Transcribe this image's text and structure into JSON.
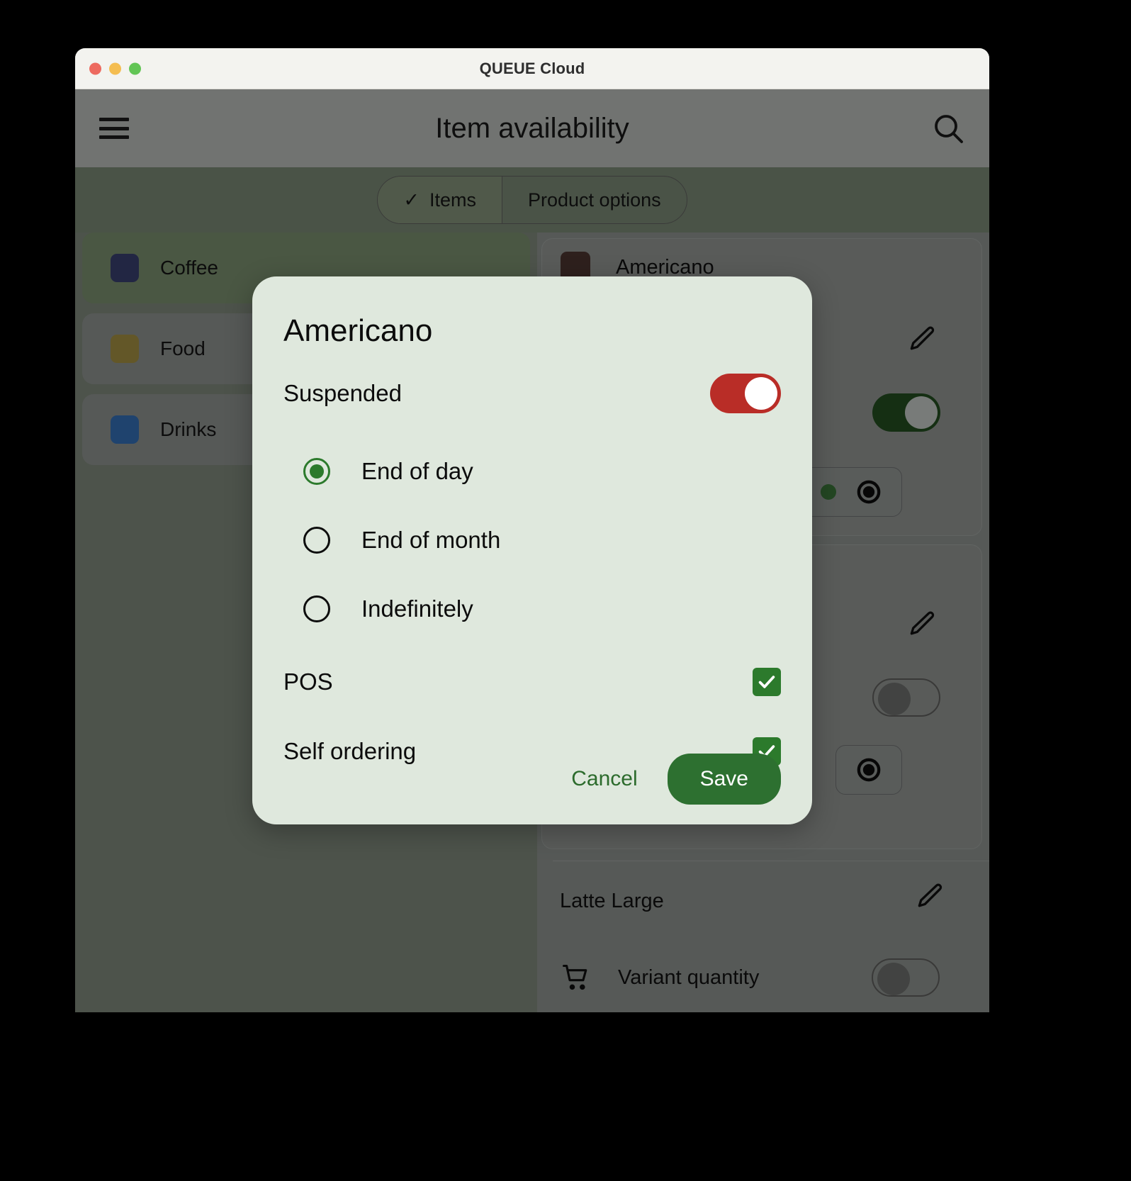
{
  "window": {
    "title": "QUEUE Cloud",
    "traffic_lights": [
      "close-red",
      "minimize-yellow",
      "maximize-green"
    ]
  },
  "appbar": {
    "menu_icon": "hamburger-icon",
    "title": "Item availability",
    "search_icon": "search-icon"
  },
  "tabs": {
    "items": {
      "label": "Items",
      "check": "✓",
      "selected": true
    },
    "product_options": {
      "label": "Product options",
      "selected": false
    }
  },
  "sidebar": {
    "categories": [
      {
        "label": "Coffee",
        "color": "#2c3157",
        "selected": true
      },
      {
        "label": "Food",
        "color": "#7f7034",
        "selected": false
      },
      {
        "label": "Drinks",
        "color": "#28568e",
        "selected": false
      }
    ]
  },
  "list": {
    "items": [
      {
        "name": "Americano",
        "swatch": "#3c2a26",
        "edit_icon": "pencil-icon",
        "toggle_state": "on",
        "chip": {
          "dot_color": "#2d5a2c",
          "icon": "target-icon"
        }
      },
      {
        "name": "Latte Large",
        "edit_icon": "pencil-icon",
        "toggle_state": "off",
        "sub_row": {
          "icon": "shopping-cart-icon",
          "label": "Variant quantity",
          "toggle_state": "off"
        }
      }
    ]
  },
  "dialog": {
    "title": "Americano",
    "suspended": {
      "label": "Suspended",
      "enabled": true,
      "toggle_color": "#b92d27"
    },
    "duration_options": [
      {
        "label": "End of day",
        "selected": true
      },
      {
        "label": "End of month",
        "selected": false
      },
      {
        "label": "Indefinitely",
        "selected": false
      }
    ],
    "channels": [
      {
        "label": "POS",
        "checked": true
      },
      {
        "label": "Self ordering",
        "checked": true
      }
    ],
    "actions": {
      "cancel": "Cancel",
      "save": "Save"
    },
    "accent_color": "#2d7030",
    "surface_color": "#dfe8dd"
  }
}
